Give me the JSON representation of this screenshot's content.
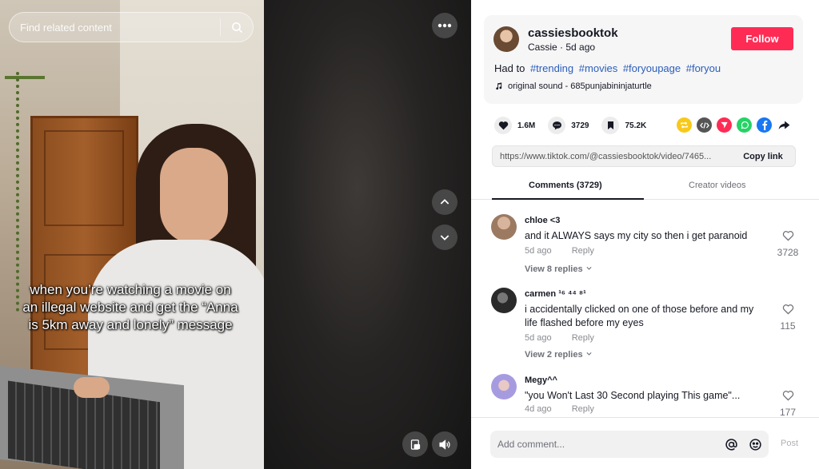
{
  "search": {
    "placeholder": "Find related content"
  },
  "video": {
    "caption": "when you’re watching a movie on an illegal website and get the “Anna is 5km away and lonely” message"
  },
  "post": {
    "username": "cassiesbooktok",
    "display_name": "Cassie",
    "separator": " · ",
    "posted": "5d ago",
    "follow_label": "Follow",
    "description_prefix": "Had to",
    "hashtags": [
      "#trending",
      "#movies",
      "#foryoupage",
      "#foryou"
    ],
    "sound": "original sound - 685punjabininjaturtle"
  },
  "stats": {
    "likes": "1.6M",
    "comments": "3729",
    "saves": "75.2K"
  },
  "share_icons": [
    {
      "name": "repost-icon",
      "color": "#f8c91a"
    },
    {
      "name": "embed-icon",
      "color": "#555555"
    },
    {
      "name": "send-icon",
      "color": "#fe2c55"
    },
    {
      "name": "whatsapp-icon",
      "color": "#25d366"
    },
    {
      "name": "facebook-icon",
      "color": "#1877f2"
    },
    {
      "name": "forward-icon",
      "color": "#161823"
    }
  ],
  "link": {
    "url": "https://www.tiktok.com/@cassiesbooktok/video/7465...",
    "copy_label": "Copy link"
  },
  "tabs": {
    "comments": "Comments (3729)",
    "creator": "Creator videos"
  },
  "comments": [
    {
      "name": "chloe <3",
      "text": "and it ALWAYS says my city so then i get paranoid",
      "time": "5d ago",
      "reply": "Reply",
      "view_replies": "View 8 replies",
      "likes": "3728"
    },
    {
      "name": "carmen ¹⁶ ⁴⁴ ⁸¹",
      "text": "i accidentally clicked on one of those before and my life flashed before my eyes",
      "time": "5d ago",
      "reply": "Reply",
      "view_replies": "View 2 replies",
      "likes": "115"
    },
    {
      "name": "Megy^^",
      "text": "\"you Won't Last 30 Second playing This game\"...",
      "time": "4d ago",
      "reply": "Reply",
      "likes": "177"
    }
  ],
  "composer": {
    "placeholder": "Add comment...",
    "post_label": "Post"
  }
}
